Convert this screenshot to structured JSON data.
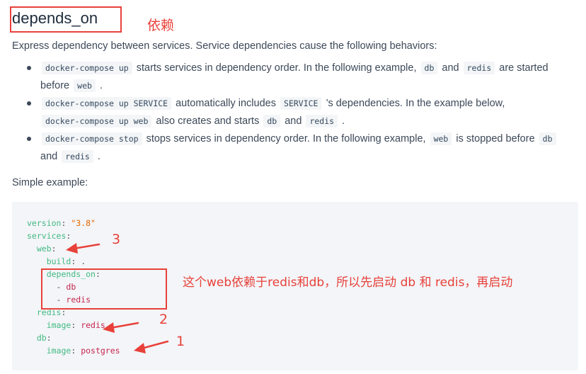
{
  "heading": {
    "title": "depends_on",
    "annotation": "依赖"
  },
  "intro": "Express dependency between services. Service dependencies cause the following behaviors:",
  "bullets": {
    "b1": {
      "code1": "docker-compose up",
      "t1": " starts services in dependency order. In the following example, ",
      "code2": "db",
      "t2": " and ",
      "code3": "redis",
      "t3": " are started",
      "t4": "before ",
      "code4": "web",
      "t5": " ."
    },
    "b2": {
      "code1": "docker-compose up SERVICE",
      "t1": " automatically includes ",
      "code2": "SERVICE",
      "t2": " ’s dependencies. In the example below,",
      "code3": "docker-compose up web",
      "t3": " also creates and starts ",
      "code4": "db",
      "t4": " and ",
      "code5": "redis",
      "t5": " ."
    },
    "b3": {
      "code1": "docker-compose stop",
      "t1": " stops services in dependency order. In the following example, ",
      "code2": "web",
      "t2": " is stopped before ",
      "code3": "db",
      "t3": "and ",
      "code4": "redis",
      "t4": " ."
    }
  },
  "simple_label": "Simple example:",
  "code": {
    "l1k": "version",
    "l1v": "\"3.8\"",
    "l2k": "services",
    "l3k": "web",
    "l4k": "build",
    "l4v": ".",
    "l5k": "depends_on",
    "l6v": "db",
    "l7v": "redis",
    "l8k": "redis",
    "l9k": "image",
    "l9v": "redis",
    "l10k": "db",
    "l11k": "image",
    "l11v": "postgres"
  },
  "annotations": {
    "n3": "3",
    "n2": "2",
    "n1": "1",
    "explain": "这个web依赖于redis和db，所以先启动 db 和 redis，再启动"
  },
  "colors": {
    "annotation_red": "#e8413a",
    "code_bg": "#f3f5f8",
    "key_green": "#42b983",
    "string_orange": "#e96900"
  }
}
